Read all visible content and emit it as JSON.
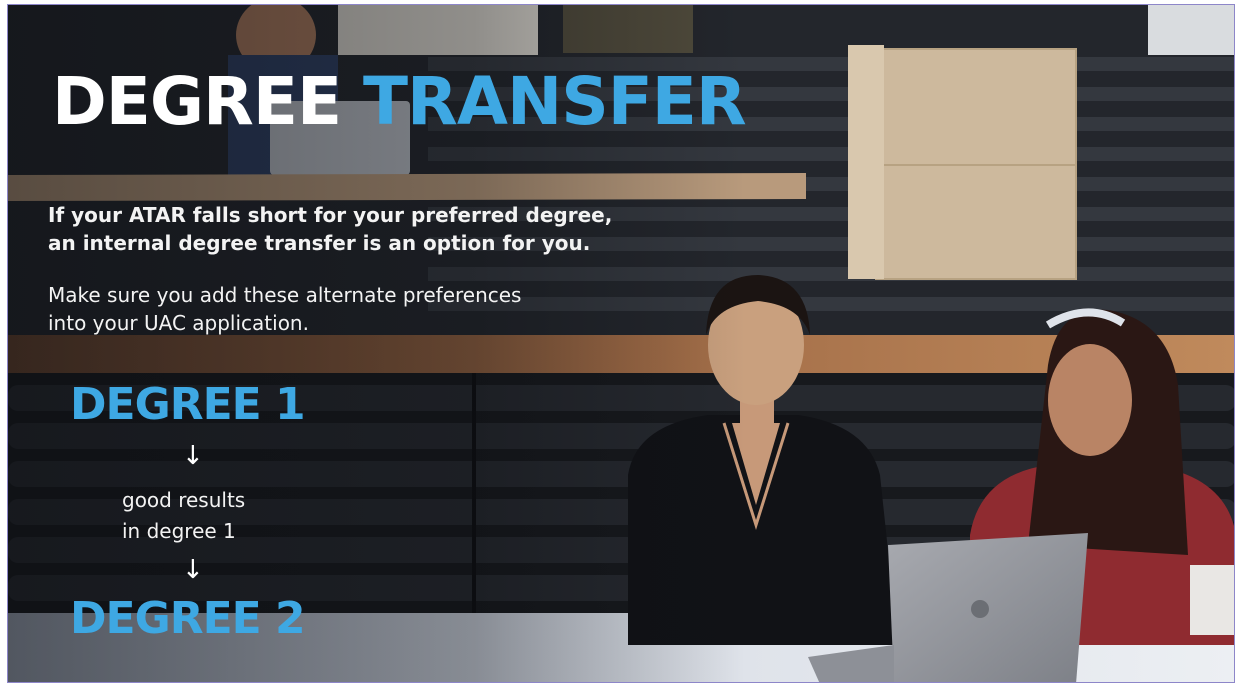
{
  "title": {
    "word1": "DEGREE",
    "word2": "TRANSFER"
  },
  "paragraphs": {
    "intro_line1": "If your ATAR falls short for your preferred degree,",
    "intro_line2": "an internal degree transfer is an option for you.",
    "advice_line1": "Make sure you add these alternate preferences",
    "advice_line2": "into your UAC application."
  },
  "flow": {
    "degree1": "DEGREE 1",
    "arrow": "↓",
    "condition_line1": "good results",
    "condition_line2": "in degree 1",
    "degree2": "DEGREE 2"
  },
  "colors": {
    "accent_blue": "#3ea8e3",
    "heading_white": "#ffffff"
  }
}
